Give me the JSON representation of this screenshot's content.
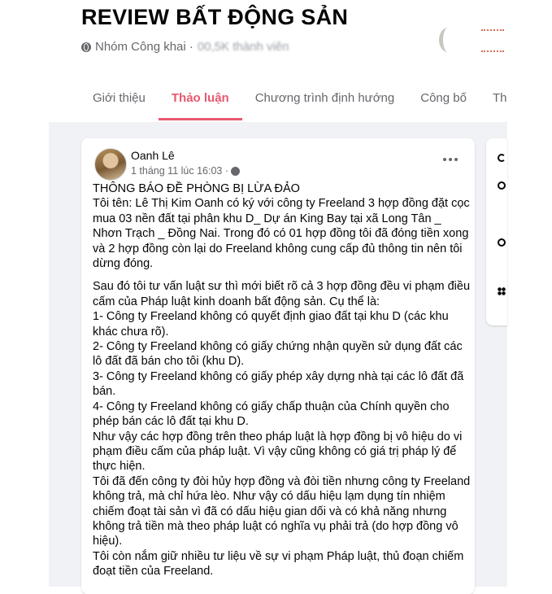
{
  "group": {
    "title": "REVIEW BẤT ĐỘNG SẢN",
    "privacy": "Nhóm Công khai ·",
    "members_blurred": "00,5K thành viên"
  },
  "tabs": [
    {
      "label": "Giới thiệu",
      "active": false
    },
    {
      "label": "Thảo luận",
      "active": true
    },
    {
      "label": "Chương trình định hướng",
      "active": false
    },
    {
      "label": "Công bố",
      "active": false
    },
    {
      "label": "Thàn",
      "active": false
    }
  ],
  "post": {
    "author": "Oanh Lê",
    "time": "1 tháng 11 lúc 16:03 ·",
    "paragraphs": [
      "THÔNG BÁO ĐỀ PHÒNG BỊ LỪA ĐẢO\nTôi tên: Lê Thị Kim Oanh có ký với công ty Freeland 3 hợp đồng đặt cọc mua 03 nền đất tại phân khu D_ Dự án King Bay tại xã Long Tân _ Nhơn Trạch _ Đồng Nai. Trong đó có 01 hợp đồng tôi đã đóng tiền xong và 2 hợp đồng còn lại do Freeland không cung cấp đủ thông tin nên tôi dừng đóng.",
      "Sau đó tôi tư vấn luật sư thì mới biết rõ cả 3 hợp đồng đều vi phạm điều cấm của Pháp luật kinh doanh bất động sản. Cụ thể là:\n1- Công ty Freeland không có quyết định giao đất tại khu D (các khu khác chưa rõ).\n2- Công ty Freeland không có giấy chứng nhận quyền sử dụng đất các lô đất đã bán cho tôi (khu D).\n3- Công ty Freeland không có giấy phép xây dựng nhà tại các lô đất đã bán.\n4- Công ty Freeland không có giấy chấp thuận của Chính quyền cho phép bán các lô đất tại khu D.\nNhư vậy các hợp đồng trên theo pháp luật là hợp đồng bị vô hiệu do vi phạm điều cấm của pháp luật. Vì vậy cũng không có giá trị pháp lý để thực hiện.\nTôi đã đến công ty đòi hủy hợp đồng và đòi tiền nhưng công ty Freeland không trả, mà chỉ hứa lèo. Như vậy có dấu hiệu lạm dụng tín nhiệm chiếm đoạt tài sản vì đã có dấu hiệu gian dối và có khả năng nhưng không trả tiền mà theo pháp luật có nghĩa vụ phải trả (do hợp đồng vô hiệu).\nTôi còn nắm giữ nhiều tư liệu về sự vi phạm Pháp luật, thủ đoạn chiếm đoạt tiền của Freeland."
    ]
  },
  "colors": {
    "accent": "#e8586e",
    "feed_background": "#f0f2f5",
    "secondary_text": "#65676b"
  },
  "icons": [
    "globe-icon",
    "privacy-icon",
    "more-options-icon"
  ]
}
